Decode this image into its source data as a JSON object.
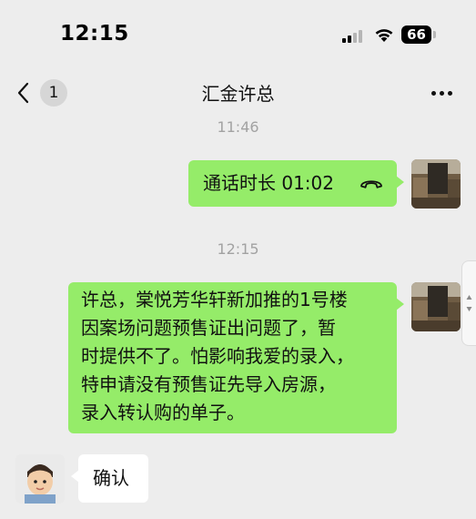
{
  "status_bar": {
    "time": "12:15",
    "battery_level": "66"
  },
  "nav": {
    "back_badge": "1",
    "title": "汇金许总"
  },
  "messages": [
    {
      "type": "timestamp",
      "text": "11:46"
    },
    {
      "type": "call",
      "sender": "me",
      "text": "通话时长 01:02"
    },
    {
      "type": "timestamp",
      "text": "12:15"
    },
    {
      "type": "text",
      "sender": "me",
      "lines": [
        "许总，棠悦芳华轩新加推的1号楼",
        "因案场问题预售证出问题了，暂",
        "时提供不了。怕影响我爱的录入，",
        "特申请没有预售证先导入房源，",
        "录入转认购的单子。"
      ]
    },
    {
      "type": "text",
      "sender": "them",
      "text": "确认"
    }
  ],
  "colors": {
    "my_bubble": "#95ec69",
    "their_bubble": "#ffffff",
    "background": "#ededed",
    "timestamp": "#a2a2a2"
  },
  "icons": [
    "signal-icon",
    "wifi-icon",
    "battery-icon",
    "back-chevron-icon",
    "more-icon",
    "phone-hangup-icon",
    "scroll-handle-icon"
  ]
}
